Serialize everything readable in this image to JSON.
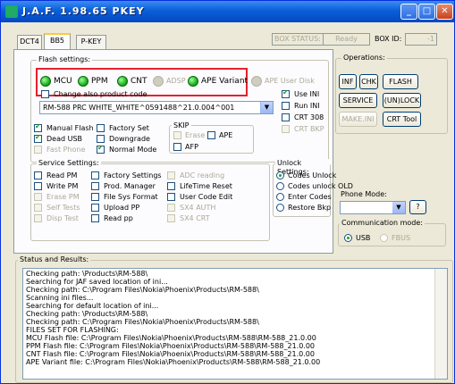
{
  "window": {
    "title": "J.A.F.  1.98.65 PKEY"
  },
  "tabs": [
    {
      "label": "DCT4"
    },
    {
      "label": "BB5"
    },
    {
      "label": "P-KEY"
    }
  ],
  "box": {
    "status_label": "BOX STATUS:",
    "status_value": "Ready",
    "id_label": "BOX ID:",
    "id_value": "-1"
  },
  "flash_settings": {
    "title": "Flash settings:",
    "leds": [
      {
        "label": "MCU"
      },
      {
        "label": "PPM"
      },
      {
        "label": "CNT"
      },
      {
        "label": "ADSP"
      },
      {
        "label": "APE Variant"
      },
      {
        "label": "APE User Disk"
      }
    ]
  },
  "product": {
    "change_label": "Change also product code",
    "value": "RM-588 PRC WHITE_WHITE^0591488^21.0.004^001"
  },
  "ini_opts": [
    {
      "label": "Use INI"
    },
    {
      "label": "Run INI"
    },
    {
      "label": "CRT 308"
    },
    {
      "label": "CRT BKP"
    }
  ],
  "flash_opts": [
    {
      "label": "Manual Flash"
    },
    {
      "label": "Dead USB"
    },
    {
      "label": "Fast Phone"
    },
    {
      "label": "Factory Set"
    },
    {
      "label": "Downgrade"
    },
    {
      "label": "Normal Mode"
    }
  ],
  "skip": {
    "title": "SKIP",
    "erase": "Erase",
    "ape": "APE",
    "afp": "AFP"
  },
  "service": {
    "title": "Service Settings:",
    "items": [
      {
        "label": "Read PM"
      },
      {
        "label": "Write PM"
      },
      {
        "label": "Erase PM"
      },
      {
        "label": "Self Tests"
      },
      {
        "label": "Disp Test"
      },
      {
        "label": "Factory Settings"
      },
      {
        "label": "Prod. Manager"
      },
      {
        "label": "File Sys Format"
      },
      {
        "label": "Upload PP"
      },
      {
        "label": "Read pp"
      },
      {
        "label": "ADC reading"
      },
      {
        "label": "LifeTime Reset"
      },
      {
        "label": "User Code Edit"
      },
      {
        "label": "SX4 AUTH"
      },
      {
        "label": "SX4 CRT"
      }
    ]
  },
  "unlock": {
    "title": "Unlock Settings:",
    "items": [
      {
        "label": "Codes Unlock"
      },
      {
        "label": "Codes unlock OLD"
      },
      {
        "label": "Enter Codes"
      },
      {
        "label": "Restore Bkp"
      }
    ]
  },
  "operations": {
    "title": "Operations:",
    "buttons": [
      {
        "label": "INF"
      },
      {
        "label": "CHK"
      },
      {
        "label": "FLASH"
      },
      {
        "label": "SERVICE"
      },
      {
        "label": "(UN)LOCK"
      },
      {
        "label": "MAKE.INI"
      },
      {
        "label": "CRT Tool"
      }
    ]
  },
  "phone_mode": {
    "title": "Phone Mode:",
    "help": "?"
  },
  "comm_mode": {
    "title": "Communication mode:",
    "usb": "USB",
    "fbus": "FBUS"
  },
  "status": {
    "title": "Status and Results:",
    "lines": [
      "Checking path: \\Products\\RM-588\\",
      "Searching for JAF saved location of ini...",
      "Checking path: C:\\Program Files\\Nokia\\Phoenix\\Products\\RM-588\\",
      "Scanning ini files...",
      "Searching for default location of ini...",
      "Checking path: \\Products\\RM-588\\",
      "Checking path: C:\\Program Files\\Nokia\\Phoenix\\Products\\RM-588\\",
      "FILES SET FOR FLASHING:",
      "MCU Flash file: C:\\Program Files\\Nokia\\Phoenix\\Products\\RM-588\\RM-588_21.0.00",
      "PPM Flash file: C:\\Program Files\\Nokia\\Phoenix\\Products\\RM-588\\RM-588_21.0.00",
      "CNT Flash file: C:\\Program Files\\Nokia\\Phoenix\\Products\\RM-588\\RM-588_21.0.00",
      "APE Variant file: C:\\Program Files\\Nokia\\Phoenix\\Products\\RM-588\\RM-588_21.0.00"
    ]
  }
}
